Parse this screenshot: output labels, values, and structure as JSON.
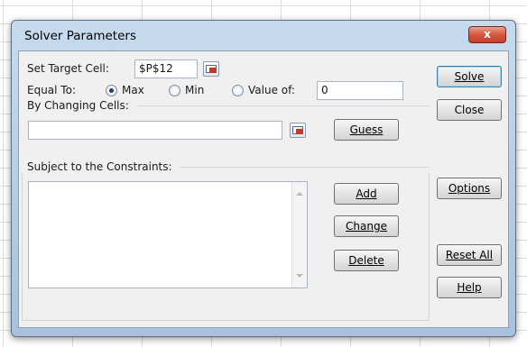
{
  "dialog": {
    "title": "Solver Parameters",
    "close_label": "x"
  },
  "target": {
    "label": "Set Target Cell:",
    "value": "$P$12"
  },
  "equal_to": {
    "label": "Equal To:",
    "options": [
      "Max",
      "Min",
      "Value of:"
    ],
    "selected": "Max",
    "value_of": "0"
  },
  "changing": {
    "label": "By Changing Cells:",
    "value": ""
  },
  "constraints": {
    "label": "Subject to the Constraints:",
    "items": []
  },
  "buttons": {
    "solve": "Solve",
    "close": "Close",
    "guess": "Guess",
    "options": "Options",
    "add": "Add",
    "change": "Change",
    "delete": "Delete",
    "reset_all": "Reset All",
    "help": "Help"
  }
}
